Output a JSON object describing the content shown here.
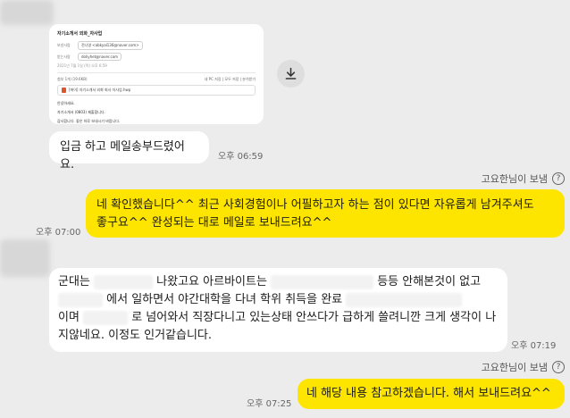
{
  "email_preview": {
    "subject": "자기소개서 외화_자사업",
    "from_label": "보낸사람",
    "from_value": "전나영 <abkyal136@naver.com>",
    "to_label": "받는사람",
    "to_value": "doliyhet@naver.com",
    "date": "2021년 7월 1일 (목) 오후 6:59",
    "attachment_header": "첨부 1개 (19.6KB)",
    "attachment_actions": "내 PC 저장 | 모두 저장 | 분석받기",
    "attachment_name": "[에이] 자기소개서 외화 회사 자사업.hwp",
    "body_lines": [
      "안녕하세요.",
      "자기소개서 (0803) 제출합니다.",
      "감사합니다. 좋은 하루 보내시기 바랍니다."
    ]
  },
  "messages": [
    {
      "text": "입금 하고 메일송부드렸어요.",
      "time": "오후 06:59"
    },
    {
      "text_line1": "네 확인했습니다^^ 최근 사회경험이나 어필하고자 하는 점이 있다면 자유롭게 남겨주셔도",
      "text_line2": "좋구요^^ 완성되는 대로 메일로 보내드려요^^",
      "time": "오후 07:00"
    },
    {
      "seg1": "군대는",
      "seg2": "나왔고요 아르바이트는",
      "seg3": "등등 안해본것이 없고",
      "seg4": "에서 일하면서 야간대학을 다녀 학위 취득을 완료",
      "seg5": "이며",
      "seg6": "로 넘어와서 직장다니고 있는상태 안쓰다가 급하게 쓸려니깐 크게 생각이 나",
      "seg7": "지않네요. 이정도 인거같습니다.",
      "time": "오후 07:19"
    },
    {
      "text": "네 해당 내용 참고하겠습니다. 해서 보내드려요^^",
      "time": "오후 07:25"
    }
  ],
  "reader_label_1": "고요한님이 보냄",
  "reader_label_2": "고요한님이 보냄",
  "icons": {
    "download": "download-icon",
    "help": "help-icon"
  },
  "colors": {
    "background": "#ececec",
    "my_bubble": "#fee500",
    "their_bubble": "#ffffff"
  }
}
